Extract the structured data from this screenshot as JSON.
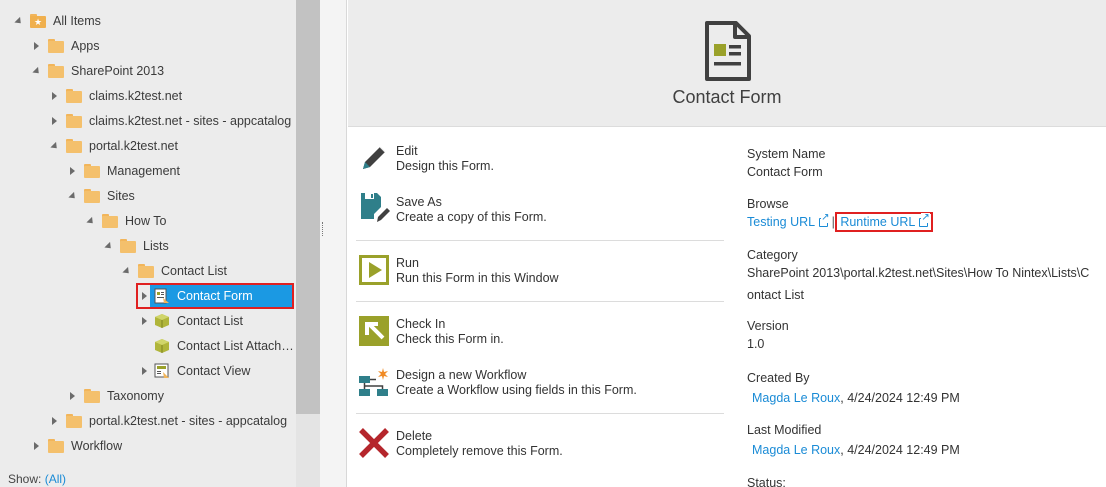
{
  "tree": {
    "items": [
      {
        "label": "All Items",
        "icon": "folder-star-icon"
      },
      {
        "label": "Apps",
        "icon": "folder-icon"
      },
      {
        "label": "SharePoint 2013",
        "icon": "folder-icon"
      },
      {
        "label": "claims.k2test.net",
        "icon": "folder-icon"
      },
      {
        "label": "claims.k2test.net - sites - appcatalog",
        "icon": "folder-icon"
      },
      {
        "label": "portal.k2test.net",
        "icon": "folder-icon"
      },
      {
        "label": "Management",
        "icon": "folder-icon"
      },
      {
        "label": "Sites",
        "icon": "folder-icon"
      },
      {
        "label": "How To",
        "icon": "folder-icon"
      },
      {
        "label": "Lists",
        "icon": "folder-icon"
      },
      {
        "label": "Contact List",
        "icon": "folder-icon"
      },
      {
        "label": "Contact Form",
        "icon": "form-icon"
      },
      {
        "label": "Contact List",
        "icon": "smartobject-icon"
      },
      {
        "label": "Contact List Attach…",
        "icon": "smartobject-icon"
      },
      {
        "label": "Contact View",
        "icon": "view-icon"
      },
      {
        "label": "Taxonomy",
        "icon": "folder-icon"
      },
      {
        "label": "portal.k2test.net - sites - appcatalog",
        "icon": "folder-icon"
      },
      {
        "label": "Workflow",
        "icon": "folder-icon"
      }
    ],
    "show_label": "Show:",
    "show_value": "(All)"
  },
  "detail": {
    "title": "Contact Form",
    "actions": [
      {
        "name": "Edit",
        "desc": "Design this Form.",
        "icon": "pencil-icon"
      },
      {
        "name": "Save As",
        "desc": "Create a copy of this Form.",
        "icon": "save-as-icon"
      },
      {
        "name": "Run",
        "desc": "Run this Form in this Window",
        "icon": "run-icon"
      },
      {
        "name": "Check In",
        "desc": "Check this Form in.",
        "icon": "check-in-icon"
      },
      {
        "name": "Design a new Workflow",
        "desc": "Create a Workflow using fields in this Form.",
        "icon": "workflow-icon"
      },
      {
        "name": "Delete",
        "desc": "Completely remove this Form.",
        "icon": "delete-icon"
      }
    ],
    "props": {
      "system_name_label": "System Name",
      "system_name": "Contact Form",
      "browse_label": "Browse",
      "testing_url": "Testing URL",
      "separator": "|",
      "runtime_url": "Runtime URL",
      "category_label": "Category",
      "category_line1": "SharePoint 2013\\portal.k2test.net\\Sites\\How To Nintex\\Lists\\C",
      "category_line2": "ontact List",
      "version_label": "Version",
      "version": "1.0",
      "created_by_label": "Created By",
      "created_by_user": "Magda Le Roux",
      "created_by_date": ", 4/24/2024 12:49 PM",
      "modified_label": "Last Modified",
      "modified_user": "Magda Le Roux",
      "modified_date": ", 4/24/2024 12:49 PM",
      "status_label": "Status:"
    }
  },
  "colors": {
    "selected": "#1b99e3",
    "highlight_box": "#e02020",
    "link": "#1a8bd6",
    "folder": "#f4c06c",
    "olive": "#9aa12a",
    "teal": "#2f7f8a",
    "delete_red": "#b5262c"
  }
}
